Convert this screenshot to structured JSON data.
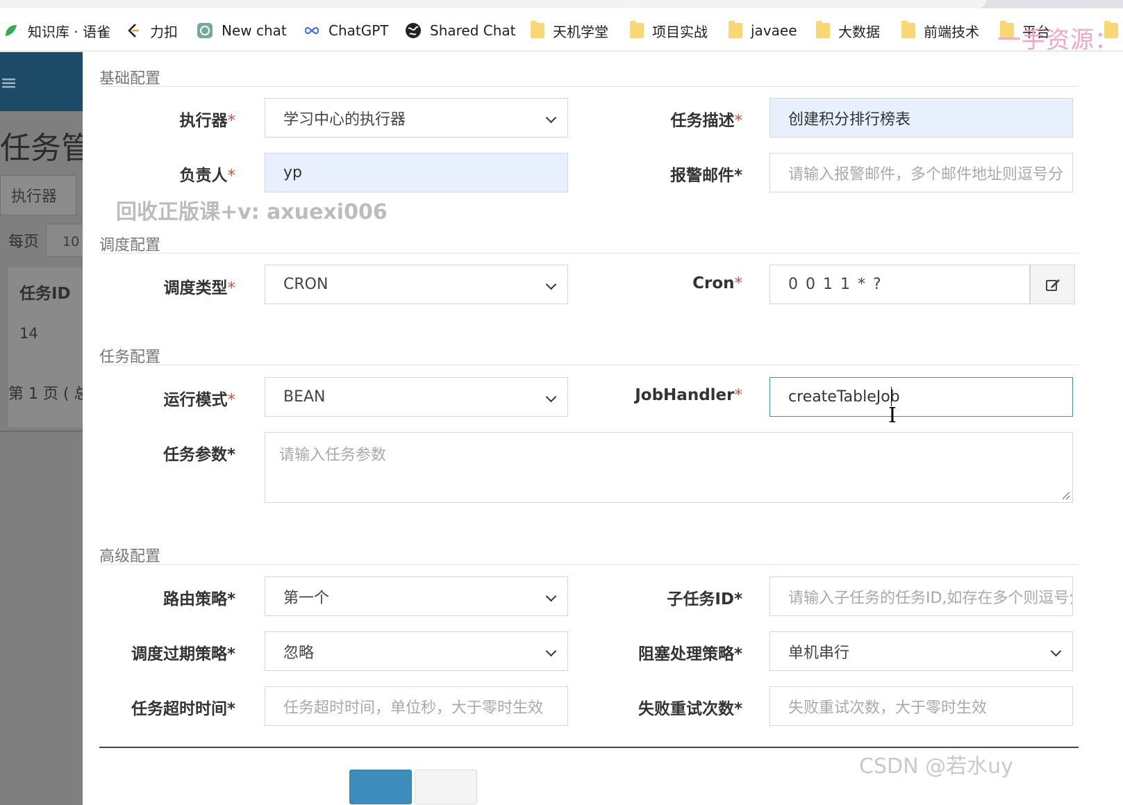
{
  "bookmarks": [
    {
      "label": "知识库 · 语雀",
      "icon": "yuque-icon"
    },
    {
      "label": "力扣",
      "icon": "leetcode-icon"
    },
    {
      "label": "New chat",
      "icon": "openai-icon"
    },
    {
      "label": "ChatGPT",
      "icon": "infinity-icon"
    },
    {
      "label": "Shared Chat",
      "icon": "globe-icon"
    },
    {
      "label": "天机学堂",
      "icon": "folder-icon"
    },
    {
      "label": "项目实战",
      "icon": "folder-icon"
    },
    {
      "label": "javaee",
      "icon": "folder-icon"
    },
    {
      "label": "大数据",
      "icon": "folder-icon"
    },
    {
      "label": "前端技术",
      "icon": "folder-icon"
    },
    {
      "label": "平台",
      "icon": "folder-icon"
    }
  ],
  "watermarks": {
    "top": "一手资源：",
    "middle": "回收正版课+v: axuexi006",
    "corner": "CSDN @若水uy"
  },
  "background_page": {
    "title": "任务管",
    "tab": "执行器",
    "per_page_label": "每页",
    "page_size": "10",
    "column_header": "任务ID",
    "row_id": "14",
    "pager_text": "第 1 页 ( 总"
  },
  "form": {
    "sections": {
      "basic": "基础配置",
      "schedule": "调度配置",
      "task": "任务配置",
      "advanced": "高级配置"
    },
    "executor": {
      "label": "执行器",
      "value": "学习中心的执行器"
    },
    "task_desc": {
      "label": "任务描述",
      "value": "创建积分排行榜表"
    },
    "owner": {
      "label": "负责人",
      "value": "yp"
    },
    "alarm_email": {
      "label": "报警邮件",
      "placeholder": "请输入报警邮件，多个邮件地址则逗号分"
    },
    "schedule_type": {
      "label": "调度类型",
      "value": "CRON"
    },
    "cron": {
      "label": "Cron",
      "value": "0 0 1 1 * ?"
    },
    "run_mode": {
      "label": "运行模式",
      "value": "BEAN"
    },
    "job_handler": {
      "label": "JobHandler",
      "value": "createTableJob"
    },
    "task_param": {
      "label": "任务参数",
      "placeholder": "请输入任务参数"
    },
    "route_strategy": {
      "label": "路由策略",
      "value": "第一个"
    },
    "child_job": {
      "label": "子任务ID",
      "placeholder": "请输入子任务的任务ID,如存在多个则逗号分"
    },
    "misfire_strategy": {
      "label": "调度过期策略",
      "value": "忽略"
    },
    "block_strategy": {
      "label": "阻塞处理策略",
      "value": "单机串行"
    },
    "timeout": {
      "label": "任务超时时间",
      "placeholder": "任务超时时间，单位秒，大于零时生效"
    },
    "fail_retry": {
      "label": "失败重试次数",
      "placeholder": "失败重试次数，大于零时生效"
    }
  },
  "colors": {
    "required": "#dd4b39",
    "primary": "#3c8dbc",
    "autofill": "#e8f0fe"
  }
}
